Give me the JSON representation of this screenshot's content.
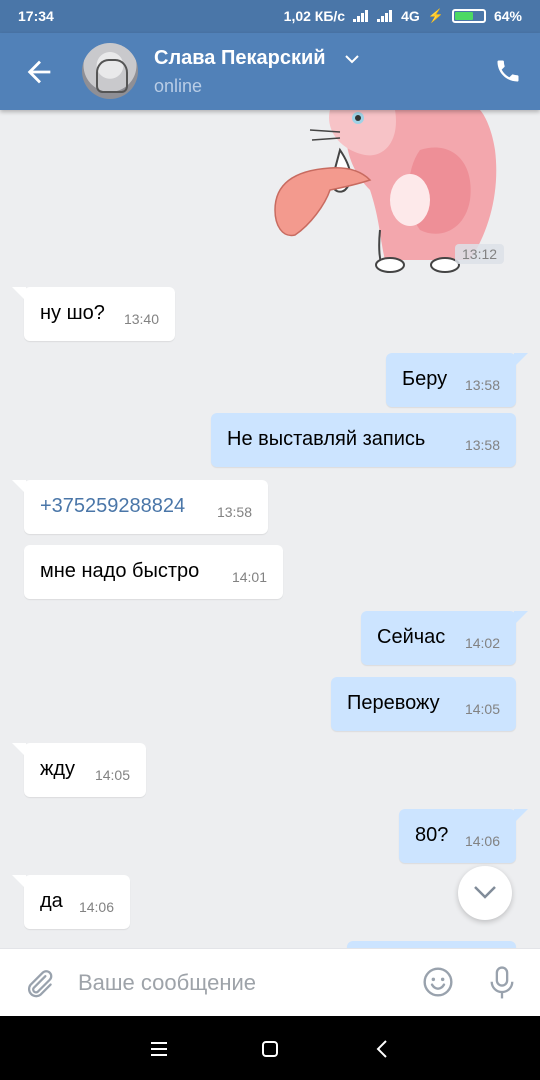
{
  "status_bar": {
    "time": "17:34",
    "speed": "1,02 КБ/с",
    "network": "4G",
    "battery": "64%",
    "battery_level": 0.64
  },
  "header": {
    "back_icon": "arrow-left-icon",
    "name": "Слава Пекарский",
    "status": "online",
    "call_icon": "phone-icon"
  },
  "chat": {
    "sticker_time": "13:12",
    "messages": [
      {
        "dir": "in",
        "text": "ну шо?",
        "time": "13:40"
      },
      {
        "dir": "out",
        "text": "Беру",
        "time": "13:58"
      },
      {
        "dir": "out",
        "text": "Не выставляй запись",
        "time": "13:58"
      },
      {
        "dir": "in",
        "text": "+375259288824",
        "time": "13:58"
      },
      {
        "dir": "in",
        "text": "мне надо быстро",
        "time": "14:01"
      },
      {
        "dir": "out",
        "text": "Сейчас",
        "time": "14:02"
      },
      {
        "dir": "out",
        "text": "Перевожу",
        "time": "14:05"
      },
      {
        "dir": "in",
        "text": "жду",
        "time": "14:05"
      },
      {
        "dir": "out",
        "text": "80?",
        "time": "14:06"
      },
      {
        "dir": "in",
        "text": "да",
        "time": "14:06"
      }
    ]
  },
  "composer": {
    "placeholder": "Ваше сообщение",
    "value": ""
  },
  "colors": {
    "header": "#5181b8",
    "status_bar": "#4a76a8",
    "incoming_bubble": "#ffffff",
    "outgoing_bubble": "#cce4ff",
    "background": "#edeef0",
    "link": "#4a76a8"
  }
}
